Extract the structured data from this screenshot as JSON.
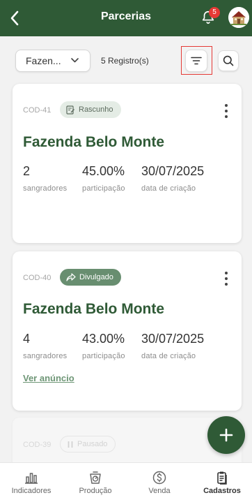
{
  "header": {
    "title": "Parcerias",
    "notification_count": "5"
  },
  "filters": {
    "farm_select": "Fazen...",
    "record_count": "5 Registro(s)"
  },
  "cards": [
    {
      "code": "COD-41",
      "status": "Rascunho",
      "title": "Fazenda Belo Monte",
      "stats": [
        {
          "value": "2",
          "label": "sangradores"
        },
        {
          "value": "45.00%",
          "label": "participação"
        },
        {
          "value": "30/07/2025",
          "label": "data de criação"
        }
      ]
    },
    {
      "code": "COD-40",
      "status": "Divulgado",
      "title": "Fazenda Belo Monte",
      "stats": [
        {
          "value": "4",
          "label": "sangradores"
        },
        {
          "value": "43.00%",
          "label": "participação"
        },
        {
          "value": "30/07/2025",
          "label": "data de criação"
        }
      ],
      "link": "Ver anúncio"
    },
    {
      "code": "COD-39",
      "status": "Pausado"
    }
  ],
  "bottom_nav": [
    {
      "label": "Indicadores",
      "icon": "bar-chart-icon"
    },
    {
      "label": "Produção",
      "icon": "scale-icon"
    },
    {
      "label": "Venda",
      "icon": "dollar-icon"
    },
    {
      "label": "Cadastros",
      "icon": "clipboard-icon",
      "active": true
    }
  ],
  "colors": {
    "primary": "#2f5a36",
    "badge": "#e53935",
    "link": "#6e9676"
  }
}
